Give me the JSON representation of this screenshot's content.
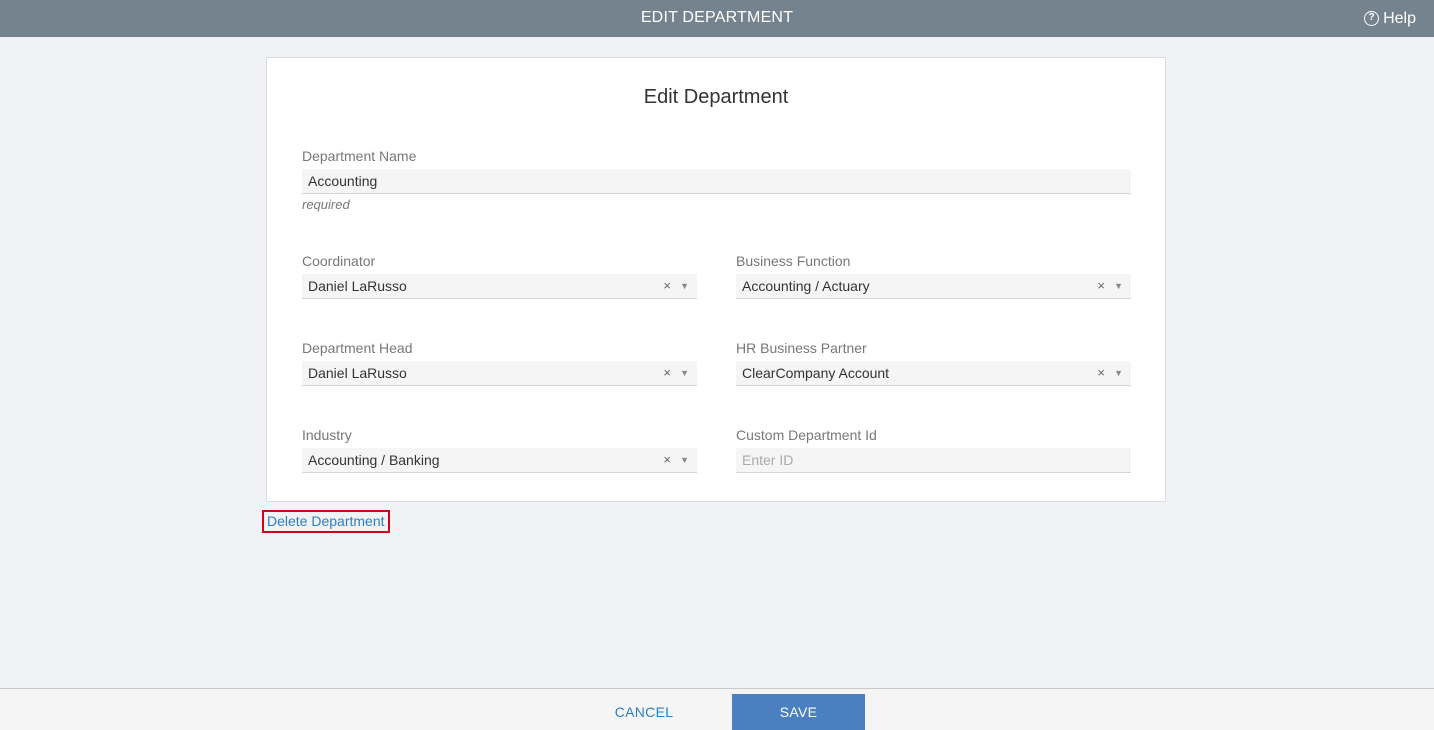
{
  "header": {
    "title": "EDIT DEPARTMENT",
    "help_label": "Help",
    "help_icon": "question-circle-icon"
  },
  "form": {
    "title": "Edit Department",
    "department_name": {
      "label": "Department Name",
      "value": "Accounting",
      "hint": "required"
    },
    "coordinator": {
      "label": "Coordinator",
      "value": "Daniel LaRusso"
    },
    "business_function": {
      "label": "Business Function",
      "value": "Accounting / Actuary"
    },
    "department_head": {
      "label": "Department Head",
      "value": "Daniel LaRusso"
    },
    "hr_business_partner": {
      "label": "HR Business Partner",
      "value": "ClearCompany Account"
    },
    "industry": {
      "label": "Industry",
      "value": "Accounting / Banking"
    },
    "custom_department_id": {
      "label": "Custom Department Id",
      "value": "",
      "placeholder": "Enter ID"
    },
    "clear_glyph": "×",
    "caret_glyph": "▼"
  },
  "actions": {
    "delete_label": "Delete Department",
    "cancel_label": "CANCEL",
    "save_label": "SAVE"
  },
  "colors": {
    "topbar": "#74838d",
    "link": "#2f7fc0",
    "primary_button": "#4a7fc0",
    "highlight_border": "#d0021b"
  }
}
